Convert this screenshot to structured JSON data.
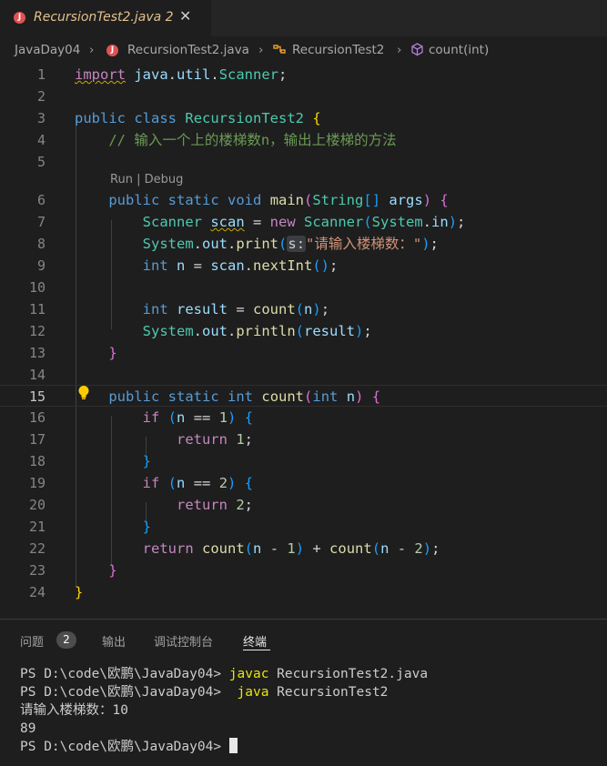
{
  "tab": {
    "icon_letter": "J",
    "filename": "RecursionTest2.java",
    "problem_count": "2",
    "close_glyph": "✕"
  },
  "breadcrumb": {
    "items": [
      "JavaDay04",
      "RecursionTest2.java",
      "RecursionTest2",
      "count(int)"
    ],
    "icons": [
      "java-file-icon",
      "class-icon",
      "method-icon"
    ]
  },
  "editor": {
    "codelens": {
      "run": "Run",
      "sep": " | ",
      "debug": "Debug"
    },
    "current_line": "15",
    "line_numbers": [
      "1",
      "2",
      "3",
      "4",
      "5",
      "6",
      "7",
      "8",
      "9",
      "10",
      "11",
      "12",
      "13",
      "14",
      "15",
      "16",
      "17",
      "18",
      "19",
      "20",
      "21",
      "22",
      "23",
      "24"
    ],
    "code": {
      "import_kw": "import",
      "import_pkg": "java",
      "import_util": "util",
      "import_cls": "Scanner",
      "public": "public",
      "class": "class",
      "class_name": "RecursionTest2",
      "comment": "// 输入一个上的楼梯数n，输出上楼梯的方法",
      "static": "static",
      "void": "void",
      "main": "main",
      "String": "String",
      "args": "args",
      "Scanner": "Scanner",
      "scan": "scan",
      "new": "new",
      "System": "System",
      "in": "in",
      "out": "out",
      "print": "print",
      "param_hint": "s:",
      "prompt_str": "\"请输入楼梯数：\"",
      "int": "int",
      "n": "n",
      "nextInt": "nextInt",
      "result": "result",
      "count": "count",
      "println": "println",
      "if": "if",
      "return": "return",
      "num1": "1",
      "num2": "2"
    }
  },
  "panel": {
    "tabs": [
      "问题",
      "输出",
      "调试控制台",
      "终端"
    ],
    "problems_badge": "2",
    "active_tab": "终端"
  },
  "terminal": {
    "prompt": "PS D:\\code\\欧鹏\\JavaDay04> ",
    "cmd1_exe": "javac",
    "cmd1_arg": " RecursionTest2.java",
    "cmd2_exe": " java",
    "cmd2_arg": " RecursionTest2",
    "output1": "请输入楼梯数：10",
    "output2": "89"
  }
}
